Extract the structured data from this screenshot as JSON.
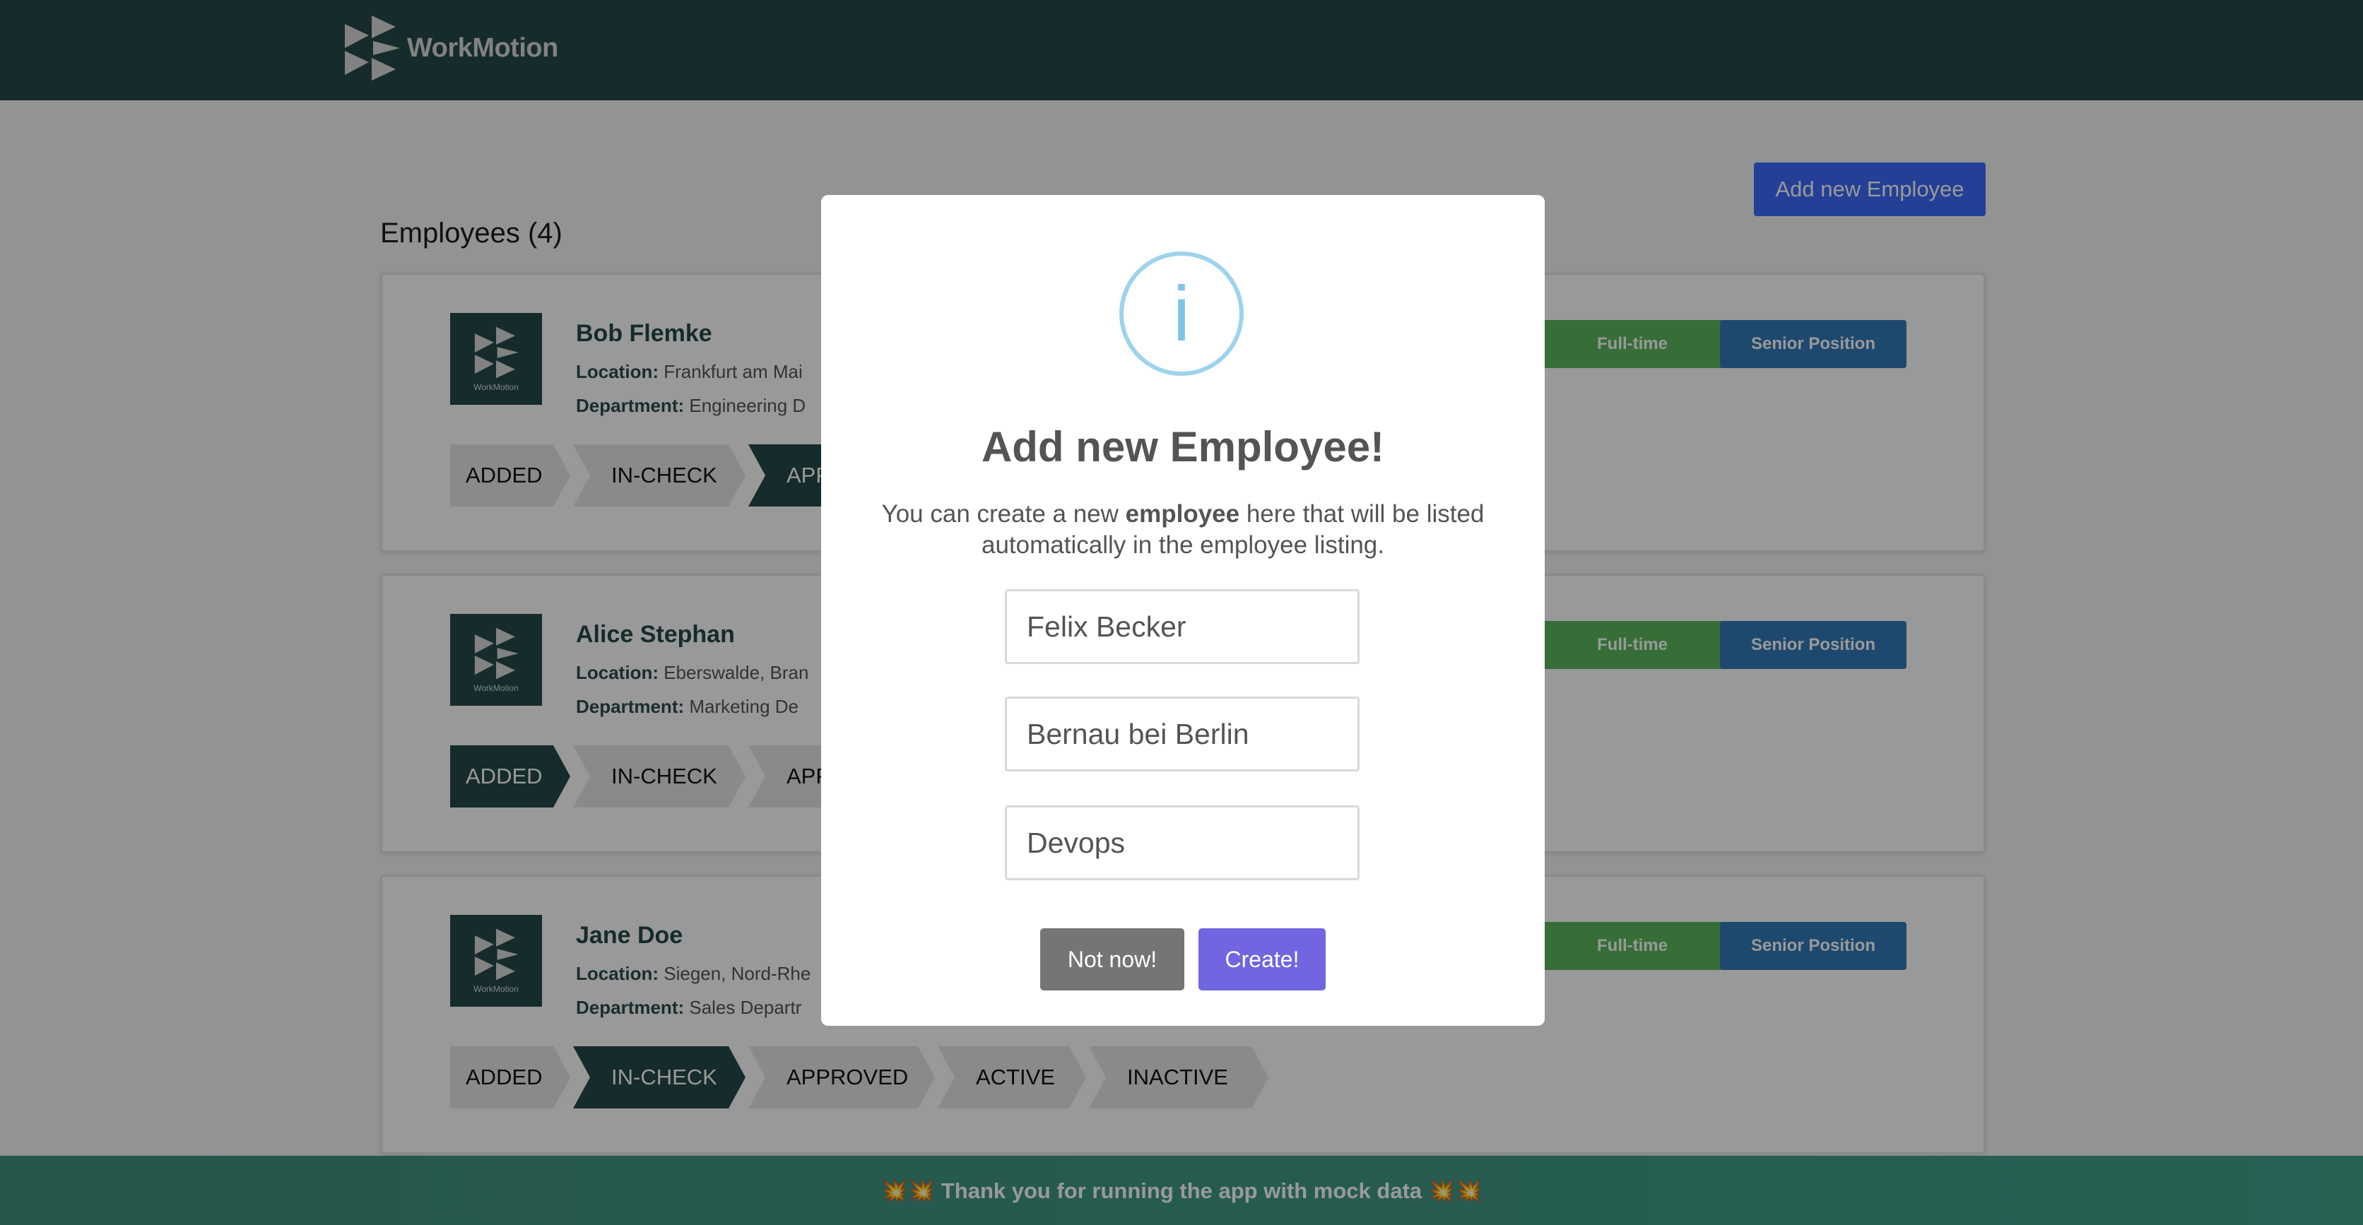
{
  "header": {
    "brand": "WorkMotion"
  },
  "page": {
    "add_button": "Add new Employee",
    "employees_title": "Employees (4)"
  },
  "employees": [
    {
      "name": "Bob Flemke",
      "location_label": "Location:",
      "location": "Frankfurt am Mai",
      "department_label": "Department:",
      "department": "Engineering D",
      "tags": [
        "Full-time",
        "Senior Position"
      ],
      "steps": [
        "ADDED",
        "IN-CHECK",
        "APP"
      ],
      "active_step": "APPROVED"
    },
    {
      "name": "Alice Stephan",
      "location_label": "Location:",
      "location": "Eberswalde, Bran",
      "department_label": "Department:",
      "department": "Marketing De",
      "tags": [
        "Full-time",
        "Senior Position"
      ],
      "steps": [
        "ADDED",
        "IN-CHECK",
        "APP"
      ],
      "active_step": "ADDED"
    },
    {
      "name": "Jane Doe",
      "location_label": "Location:",
      "location": "Siegen, Nord-Rhe",
      "department_label": "Department:",
      "department": "Sales Departr",
      "tags": [
        "Full-time",
        "Senior Position"
      ],
      "steps": [
        "ADDED",
        "IN-CHECK",
        "APPROVED",
        "ACTIVE",
        "INACTIVE"
      ],
      "active_step": "IN-CHECK"
    }
  ],
  "avatar_mini_text": "WorkMotion",
  "footer": {
    "message": "💥💥 Thank you for running the app with mock data 💥💥"
  },
  "modal": {
    "icon": "info-icon",
    "icon_glyph": "i",
    "title": "Add new Employee!",
    "text_before": "You can create a new ",
    "text_bold": "employee",
    "text_after": " here that will be listed automatically in the employee listing.",
    "name_value": "Felix Becker",
    "location_value": "Bernau bei Berlin",
    "department_value": "Devops",
    "cancel_label": "Not now!",
    "create_label": "Create!"
  },
  "colors": {
    "header": "#264849",
    "primary_button": "#3b6bfb",
    "fulltime_tag": "#5cb85c",
    "senior_tag": "#337ab7",
    "create_button": "#7066e0",
    "cancel_button": "#757575"
  }
}
